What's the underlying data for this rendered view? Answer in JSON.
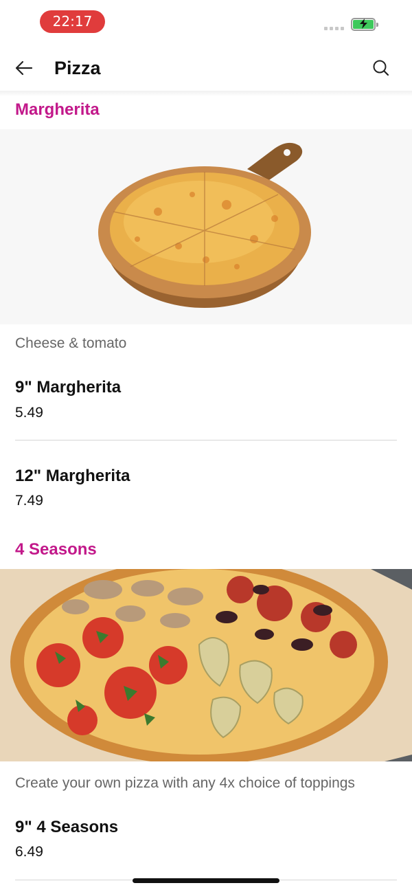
{
  "status_bar": {
    "time": "22:17"
  },
  "header": {
    "title": "Pizza"
  },
  "sections": [
    {
      "title": "Margherita",
      "description": "Cheese & tomato",
      "items": [
        {
          "name": "9\" Margherita",
          "price": "5.49"
        },
        {
          "name": "12\" Margherita",
          "price": "7.49"
        }
      ]
    },
    {
      "title": "4 Seasons",
      "description": "Create your own pizza with any 4x choice of toppings",
      "items": [
        {
          "name": "9\" 4 Seasons",
          "price": "6.49"
        }
      ]
    }
  ],
  "colors": {
    "accent": "#c2188a",
    "status_pill": "#e03c3c",
    "battery": "#3ec95c"
  },
  "icons": [
    "back-arrow-icon",
    "search-icon",
    "battery-charging-icon",
    "signal-icon"
  ]
}
